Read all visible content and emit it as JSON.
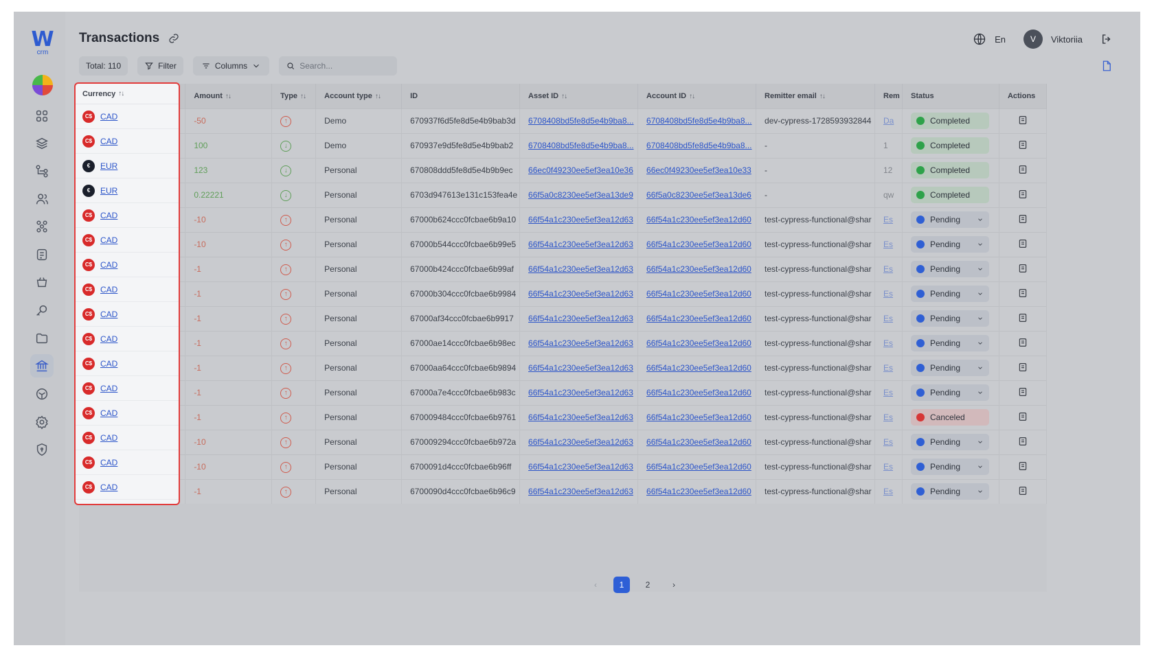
{
  "page": {
    "title": "Transactions"
  },
  "header": {
    "language": "En",
    "user_initial": "V",
    "user_name": "Viktoriia"
  },
  "logo": {
    "mark": "W",
    "sub": "crm"
  },
  "toolbar": {
    "total": "Total: 110",
    "filter": "Filter",
    "columns": "Columns",
    "search_placeholder": "Search..."
  },
  "columns": [
    "Currency",
    "Amount",
    "Type",
    "Account type",
    "ID",
    "Asset ID",
    "Account ID",
    "Remitter email",
    "Rem",
    "Status",
    "Actions"
  ],
  "rows": [
    {
      "currency": "CAD",
      "amount": "-50",
      "dir": "out",
      "account_type": "Demo",
      "id": "670937f6d5fe8d5e4b9bab3d",
      "asset_id": "6708408bd5fe8d5e4b9ba8...",
      "account_id": "6708408bd5fe8d5e4b9ba8...",
      "email": "dev-cypress-1728593932844",
      "rem": "Da",
      "status": "Completed"
    },
    {
      "currency": "CAD",
      "amount": "100",
      "dir": "in",
      "account_type": "Demo",
      "id": "670937e9d5fe8d5e4b9bab2",
      "asset_id": "6708408bd5fe8d5e4b9ba8...",
      "account_id": "6708408bd5fe8d5e4b9ba8...",
      "email": "-",
      "rem": "1",
      "status": "Completed"
    },
    {
      "currency": "EUR",
      "amount": "123",
      "dir": "in",
      "account_type": "Personal",
      "id": "670808ddd5fe8d5e4b9b9ec",
      "asset_id": "66ec0f49230ee5ef3ea10e36",
      "account_id": "66ec0f49230ee5ef3ea10e33",
      "email": "-",
      "rem": "12",
      "status": "Completed"
    },
    {
      "currency": "EUR",
      "amount": "0.22221",
      "dir": "in",
      "account_type": "Personal",
      "id": "6703d947613e131c153fea4e",
      "asset_id": "66f5a0c8230ee5ef3ea13de9",
      "account_id": "66f5a0c8230ee5ef3ea13de6",
      "email": "-",
      "rem": "qw",
      "status": "Completed"
    },
    {
      "currency": "CAD",
      "amount": "-10",
      "dir": "out",
      "account_type": "Personal",
      "id": "67000b624ccc0fcbae6b9a10",
      "asset_id": "66f54a1c230ee5ef3ea12d63",
      "account_id": "66f54a1c230ee5ef3ea12d60",
      "email": "test-cypress-functional@shar",
      "rem": "Es",
      "status": "Pending"
    },
    {
      "currency": "CAD",
      "amount": "-10",
      "dir": "out",
      "account_type": "Personal",
      "id": "67000b544ccc0fcbae6b99e5",
      "asset_id": "66f54a1c230ee5ef3ea12d63",
      "account_id": "66f54a1c230ee5ef3ea12d60",
      "email": "test-cypress-functional@shar",
      "rem": "Es",
      "status": "Pending"
    },
    {
      "currency": "CAD",
      "amount": "-1",
      "dir": "out",
      "account_type": "Personal",
      "id": "67000b424ccc0fcbae6b99af",
      "asset_id": "66f54a1c230ee5ef3ea12d63",
      "account_id": "66f54a1c230ee5ef3ea12d60",
      "email": "test-cypress-functional@shar",
      "rem": "Es",
      "status": "Pending"
    },
    {
      "currency": "CAD",
      "amount": "-1",
      "dir": "out",
      "account_type": "Personal",
      "id": "67000b304ccc0fcbae6b9984",
      "asset_id": "66f54a1c230ee5ef3ea12d63",
      "account_id": "66f54a1c230ee5ef3ea12d60",
      "email": "test-cypress-functional@shar",
      "rem": "Es",
      "status": "Pending"
    },
    {
      "currency": "CAD",
      "amount": "-1",
      "dir": "out",
      "account_type": "Personal",
      "id": "67000af34ccc0fcbae6b9917",
      "asset_id": "66f54a1c230ee5ef3ea12d63",
      "account_id": "66f54a1c230ee5ef3ea12d60",
      "email": "test-cypress-functional@shar",
      "rem": "Es",
      "status": "Pending"
    },
    {
      "currency": "CAD",
      "amount": "-1",
      "dir": "out",
      "account_type": "Personal",
      "id": "67000ae14ccc0fcbae6b98ec",
      "asset_id": "66f54a1c230ee5ef3ea12d63",
      "account_id": "66f54a1c230ee5ef3ea12d60",
      "email": "test-cypress-functional@shar",
      "rem": "Es",
      "status": "Pending"
    },
    {
      "currency": "CAD",
      "amount": "-1",
      "dir": "out",
      "account_type": "Personal",
      "id": "67000aa64ccc0fcbae6b9894",
      "asset_id": "66f54a1c230ee5ef3ea12d63",
      "account_id": "66f54a1c230ee5ef3ea12d60",
      "email": "test-cypress-functional@shar",
      "rem": "Es",
      "status": "Pending"
    },
    {
      "currency": "CAD",
      "amount": "-1",
      "dir": "out",
      "account_type": "Personal",
      "id": "67000a7e4ccc0fcbae6b983c",
      "asset_id": "66f54a1c230ee5ef3ea12d63",
      "account_id": "66f54a1c230ee5ef3ea12d60",
      "email": "test-cypress-functional@shar",
      "rem": "Es",
      "status": "Pending"
    },
    {
      "currency": "CAD",
      "amount": "-1",
      "dir": "out",
      "account_type": "Personal",
      "id": "670009484ccc0fcbae6b9761",
      "asset_id": "66f54a1c230ee5ef3ea12d63",
      "account_id": "66f54a1c230ee5ef3ea12d60",
      "email": "test-cypress-functional@shar",
      "rem": "Es",
      "status": "Canceled"
    },
    {
      "currency": "CAD",
      "amount": "-10",
      "dir": "out",
      "account_type": "Personal",
      "id": "670009294ccc0fcbae6b972a",
      "asset_id": "66f54a1c230ee5ef3ea12d63",
      "account_id": "66f54a1c230ee5ef3ea12d60",
      "email": "test-cypress-functional@shar",
      "rem": "Es",
      "status": "Pending"
    },
    {
      "currency": "CAD",
      "amount": "-10",
      "dir": "out",
      "account_type": "Personal",
      "id": "6700091d4ccc0fcbae6b96ff",
      "asset_id": "66f54a1c230ee5ef3ea12d63",
      "account_id": "66f54a1c230ee5ef3ea12d60",
      "email": "test-cypress-functional@shar",
      "rem": "Es",
      "status": "Pending"
    },
    {
      "currency": "CAD",
      "amount": "-1",
      "dir": "out",
      "account_type": "Personal",
      "id": "6700090d4ccc0fcbae6b96c9",
      "asset_id": "66f54a1c230ee5ef3ea12d63",
      "account_id": "66f54a1c230ee5ef3ea12d60",
      "email": "test-cypress-functional@shar",
      "rem": "Es",
      "status": "Pending"
    }
  ],
  "currency_symbols": {
    "CAD": "C$",
    "EUR": "€"
  },
  "pagination": {
    "pages": [
      "1",
      "2"
    ],
    "current": "1"
  },
  "colors": {
    "accent": "#2e5fd6",
    "highlight": "#e23b3b",
    "completed": "#2ea24a",
    "pending": "#2f5fd4",
    "canceled": "#d63636"
  }
}
